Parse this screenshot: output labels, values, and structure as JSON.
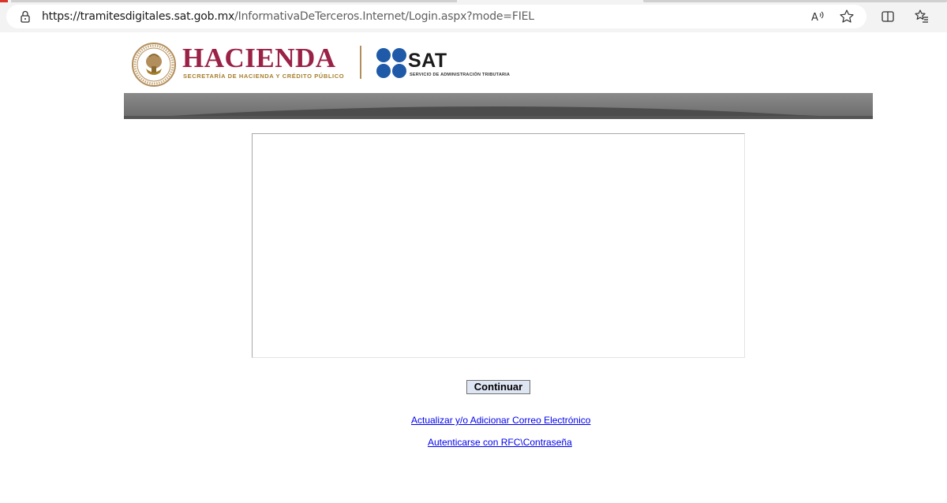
{
  "browser": {
    "url_host": "https://tramitesdigitales.sat.gob.mx",
    "url_path": "/InformativaDeTerceros.Internet/Login.aspx?mode=FIEL",
    "icons": [
      "lock-icon",
      "read-aloud-icon",
      "favorite-star-icon",
      "split-screen-icon",
      "favorites-list-icon"
    ]
  },
  "header": {
    "hacienda_title": "HACIENDA",
    "hacienda_subtitle": "SECRETARÍA DE HACIENDA Y CRÉDITO PÚBLICO",
    "sat_title": "SAT",
    "sat_subtitle": "SERVICIO DE ADMINISTRACIÓN TRIBUTARIA",
    "colors": {
      "hacienda": "#9b2247",
      "gold": "#a57f2c",
      "sat_blue": "#1e5aa8",
      "banner": "#7a7a7a"
    }
  },
  "main": {
    "continue_button": "Continuar",
    "links": {
      "update_email": "Actualizar y/o Adicionar Correo Electrónico",
      "rfc_login": "Autenticarse con RFC\\Contraseña"
    }
  }
}
